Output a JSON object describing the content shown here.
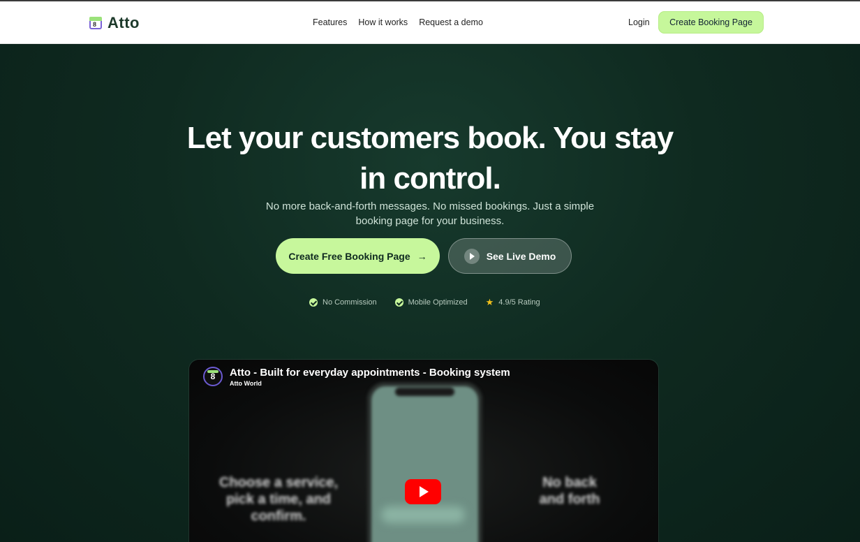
{
  "nav": {
    "brand": "Atto",
    "brand_logo_digit": "8",
    "links": [
      "Features",
      "How it works",
      "Request a demo"
    ],
    "login": "Login",
    "cta": "Create Booking Page"
  },
  "hero": {
    "title": "Let your customers book. You stay in control.",
    "subtitle": "No more back-and-forth messages. No missed bookings. Just a simple booking page for your business.",
    "primary_cta": "Create Free Booking Page",
    "primary_cta_arrow": "→",
    "secondary_cta": "See Live Demo",
    "badges": [
      "No Commission",
      "Mobile Optimized",
      "4.9/5 Rating"
    ]
  },
  "video": {
    "title": "Atto - Built for everyday appointments - Booking system",
    "channel": "Atto World",
    "channel_icon_digit": "8",
    "overlay_left": "Choose a service, pick a time, and confirm.",
    "overlay_right": "No back and forth"
  },
  "colors": {
    "accent": "#c7f79c",
    "hero_bg": "#0f2a20",
    "youtube_red": "#ff0000",
    "star": "#f4c21b"
  }
}
